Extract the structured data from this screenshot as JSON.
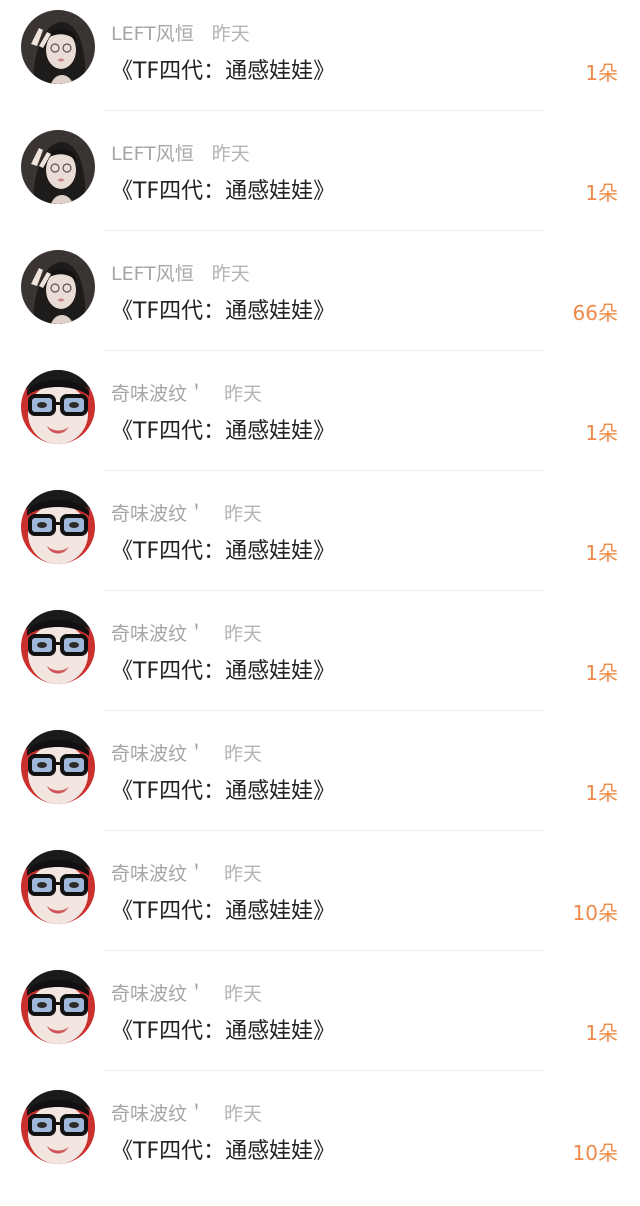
{
  "colors": {
    "name": "#a6a6a6",
    "time": "#b3b3b3",
    "title": "#222222",
    "count": "#ef8a4a",
    "divider": "#eeeeee"
  },
  "items": [
    {
      "name": "LEFT风恒",
      "time": "昨天",
      "title": "《TF四代：通感娃娃》",
      "count": "1朵",
      "avatar": "girl-photo-avatar"
    },
    {
      "name": "LEFT风恒",
      "time": "昨天",
      "title": "《TF四代：通感娃娃》",
      "count": "1朵",
      "avatar": "girl-photo-avatar"
    },
    {
      "name": "LEFT风恒",
      "time": "昨天",
      "title": "《TF四代：通感娃娃》",
      "count": "66朵",
      "avatar": "girl-photo-avatar"
    },
    {
      "name": "奇味波纹＇",
      "time": "昨天",
      "title": "《TF四代：通感娃娃》",
      "count": "1朵",
      "avatar": "glasses-face-avatar"
    },
    {
      "name": "奇味波纹＇",
      "time": "昨天",
      "title": "《TF四代：通感娃娃》",
      "count": "1朵",
      "avatar": "glasses-face-avatar"
    },
    {
      "name": "奇味波纹＇",
      "time": "昨天",
      "title": "《TF四代：通感娃娃》",
      "count": "1朵",
      "avatar": "glasses-face-avatar"
    },
    {
      "name": "奇味波纹＇",
      "time": "昨天",
      "title": "《TF四代：通感娃娃》",
      "count": "1朵",
      "avatar": "glasses-face-avatar"
    },
    {
      "name": "奇味波纹＇",
      "time": "昨天",
      "title": "《TF四代：通感娃娃》",
      "count": "10朵",
      "avatar": "glasses-face-avatar"
    },
    {
      "name": "奇味波纹＇",
      "time": "昨天",
      "title": "《TF四代：通感娃娃》",
      "count": "1朵",
      "avatar": "glasses-face-avatar"
    },
    {
      "name": "奇味波纹＇",
      "time": "昨天",
      "title": "《TF四代：通感娃娃》",
      "count": "10朵",
      "avatar": "glasses-face-avatar"
    }
  ]
}
